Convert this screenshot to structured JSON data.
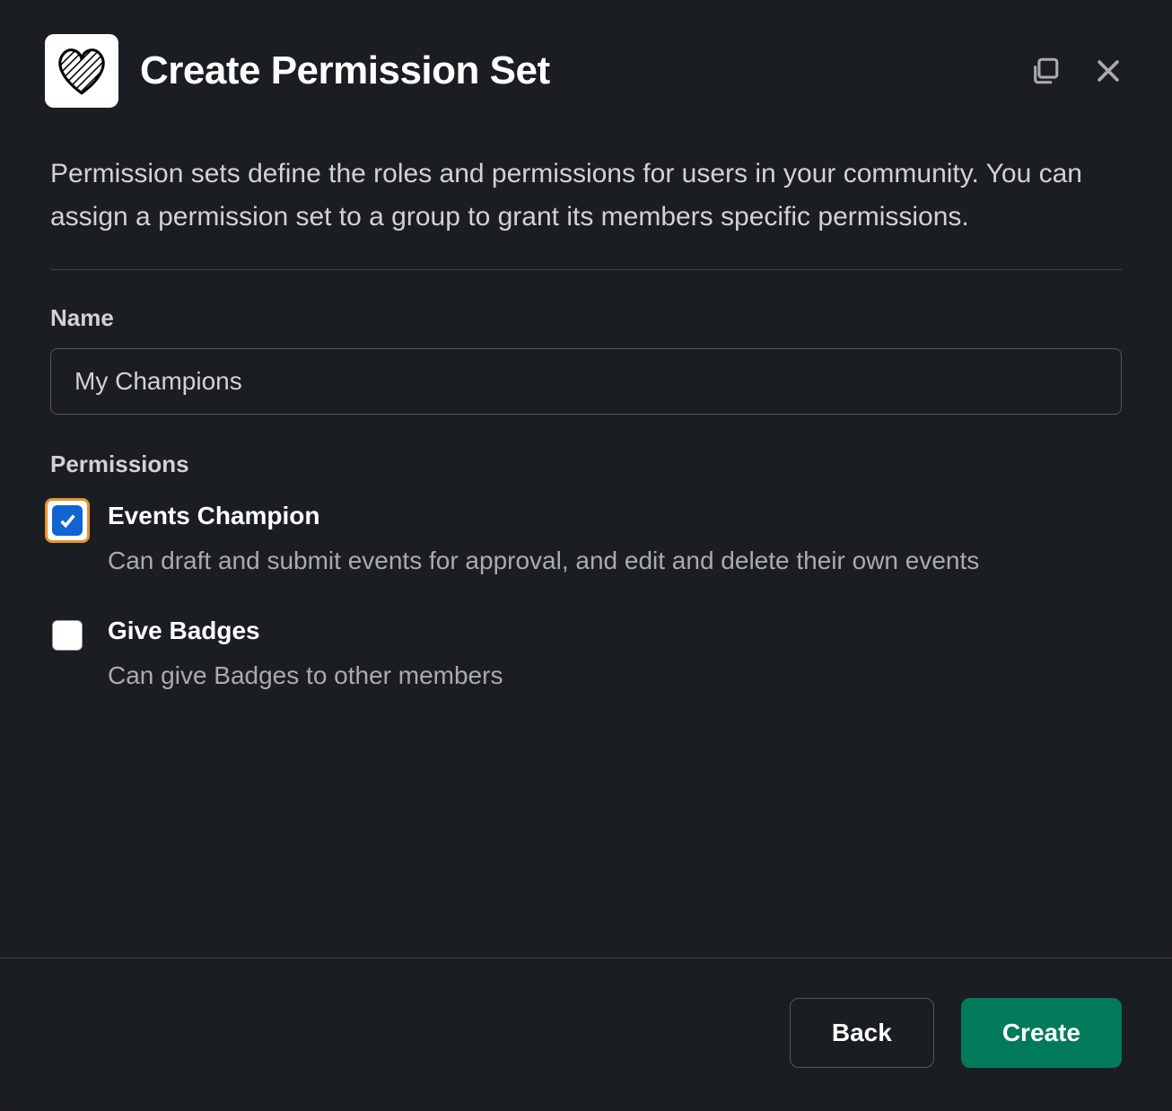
{
  "header": {
    "title": "Create Permission Set"
  },
  "body": {
    "description": "Permission sets define the roles and permissions for users in your community. You can assign a permission set to a group to grant its members specific permissions.",
    "name_label": "Name",
    "name_value": "My Champions",
    "permissions_label": "Permissions",
    "permissions": [
      {
        "title": "Events Champion",
        "description": "Can draft and submit events for approval, and edit and delete their own events",
        "checked": true,
        "focused": true
      },
      {
        "title": "Give Badges",
        "description": "Can give Badges to other members",
        "checked": false,
        "focused": false
      }
    ]
  },
  "footer": {
    "back_label": "Back",
    "create_label": "Create"
  }
}
